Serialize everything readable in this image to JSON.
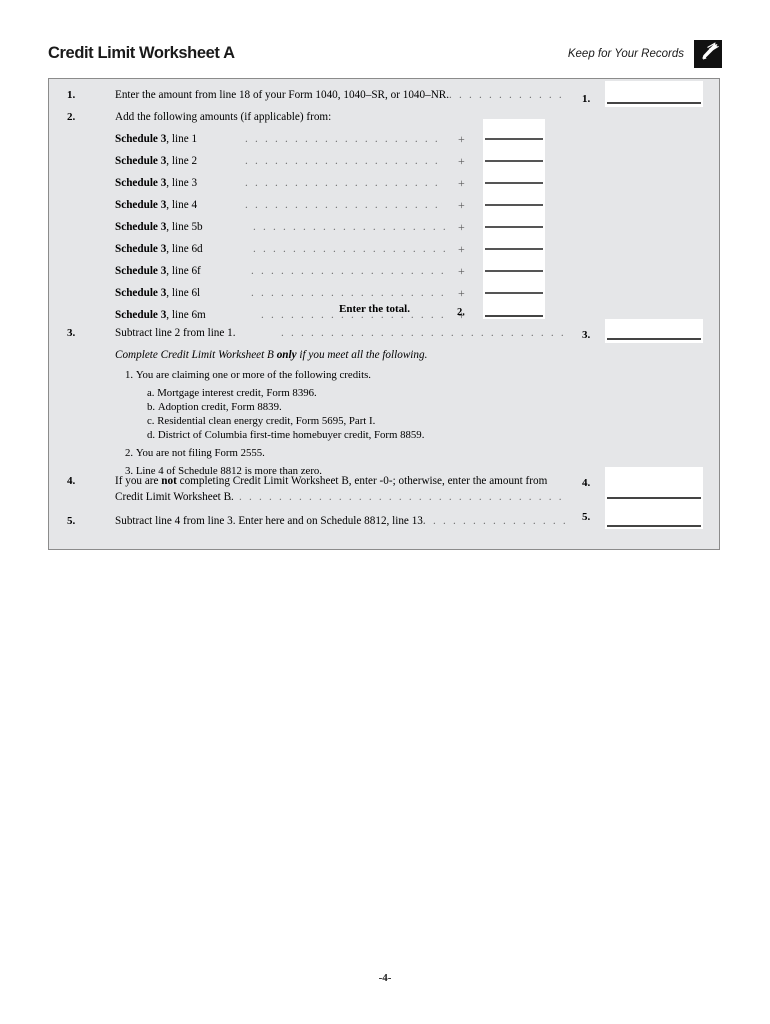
{
  "header": {
    "title": "Credit Limit Worksheet A",
    "keep_for_records": "Keep for Your Records",
    "icon": "pen-records-icon"
  },
  "worksheet": {
    "line1": {
      "number": "1.",
      "text": "Enter the amount from line 18 of your Form 1040, 1040–SR, or 1040–NR.",
      "answer_number": "1.",
      "value": ""
    },
    "line2": {
      "number": "2.",
      "text": "Add the following amounts (if applicable) from:",
      "entries": [
        {
          "source": "Schedule 3",
          "line": ", line 1",
          "operator": "+",
          "value": ""
        },
        {
          "source": "Schedule 3",
          "line": ", line 2",
          "operator": "+",
          "value": ""
        },
        {
          "source": "Schedule 3",
          "line": ", line 3",
          "operator": "+",
          "value": ""
        },
        {
          "source": "Schedule 3",
          "line": ", line 4",
          "operator": "+",
          "value": ""
        },
        {
          "source": "Schedule 3",
          "line": ", line 5b",
          "operator": "+",
          "value": ""
        },
        {
          "source": "Schedule 3",
          "line": ", line 6d",
          "operator": "+",
          "value": ""
        },
        {
          "source": "Schedule 3",
          "line": ", line 6f",
          "operator": "+",
          "value": ""
        },
        {
          "source": "Schedule 3",
          "line": ", line 6l",
          "operator": "+",
          "value": ""
        },
        {
          "source": "Schedule 3",
          "line": ", line 6m",
          "operator": "+",
          "value": ""
        }
      ],
      "total_label": "Enter the total.",
      "answer_number": "2.",
      "value": ""
    },
    "line3": {
      "number": "3.",
      "text": "Subtract line 2 from line 1.",
      "answer_number": "3.",
      "value": "",
      "note_before": "Complete Credit Limit Worksheet B ",
      "note_bold": "only",
      "note_after": " if you meet all the following.",
      "conditions": [
        {
          "number": "1.",
          "text": "You are claiming one or more of the following credits.",
          "subitems": [
            {
              "letter": "a.",
              "text": "Mortgage interest credit, Form 8396."
            },
            {
              "letter": "b.",
              "text": "Adoption credit, Form 8839."
            },
            {
              "letter": "c.",
              "text": "Residential clean energy credit, Form 5695, Part I."
            },
            {
              "letter": "d.",
              "text": "District of Columbia first-time homebuyer credit, Form 8859."
            }
          ]
        },
        {
          "number": "2.",
          "text": "You are not filing Form 2555.",
          "subitems": []
        },
        {
          "number": "3.",
          "text": "Line 4 of Schedule 8812 is more than zero.",
          "subitems": []
        }
      ]
    },
    "line4": {
      "number": "4.",
      "text_before": "If you are ",
      "text_bold": "not",
      "text_after": " completing Credit Limit Worksheet B, enter -0-; otherwise, enter the amount from",
      "text_line2": "Credit Limit Worksheet B.",
      "answer_number": "4.",
      "value": ""
    },
    "line5": {
      "number": "5.",
      "text": "Subtract line 4 from line 3. Enter here and on Schedule 8812, line 13.",
      "answer_number": "5.",
      "value": ""
    }
  },
  "footer": {
    "page_number": "-4-"
  },
  "colors": {
    "worksheet_background": "#e5e6e8",
    "worksheet_border": "#8b8b8b",
    "entry_box": "#ffffff",
    "rule": "#444444",
    "text": "#000000",
    "icon_background": "#111111"
  }
}
